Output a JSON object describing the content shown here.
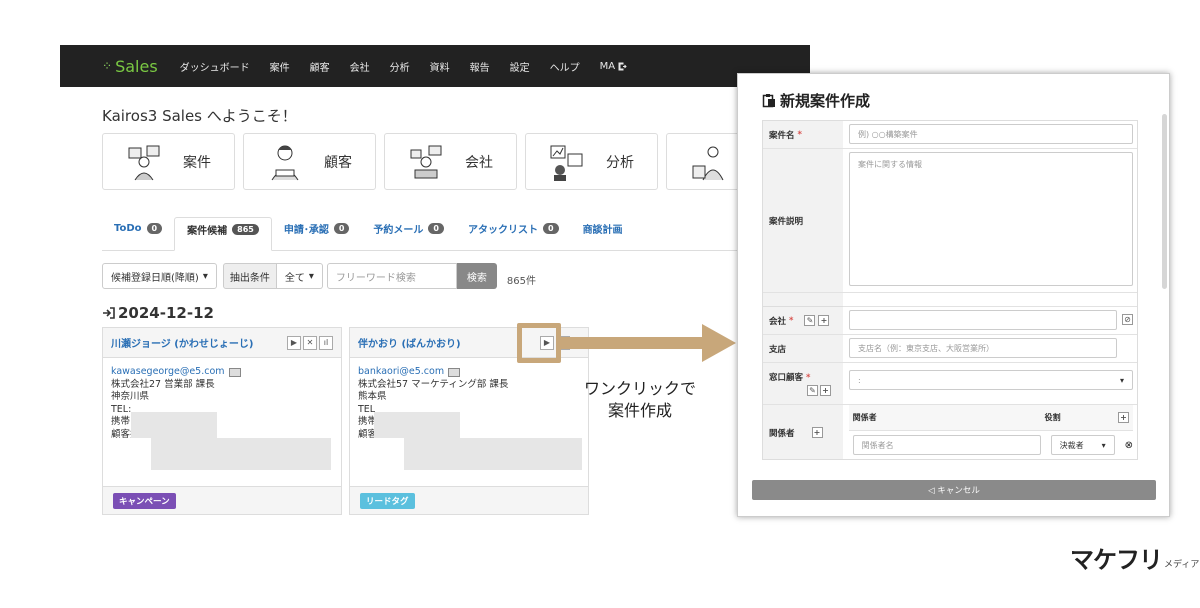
{
  "nav": {
    "logo": "Sales",
    "items": [
      "ダッシュボード",
      "案件",
      "顧客",
      "会社",
      "分析",
      "資料",
      "報告",
      "設定",
      "ヘルプ"
    ],
    "ma_label": "MA"
  },
  "welcome": "Kairos3 Sales へようこそ！",
  "tiles": [
    {
      "label": "案件"
    },
    {
      "label": "顧客"
    },
    {
      "label": "会社"
    },
    {
      "label": "分析"
    }
  ],
  "tabs": [
    {
      "label": "ToDo",
      "badge": "0"
    },
    {
      "label": "案件候補",
      "badge": "865"
    },
    {
      "label": "申請･承認",
      "badge": "0"
    },
    {
      "label": "予約メール",
      "badge": "0"
    },
    {
      "label": "アタックリスト",
      "badge": "0"
    },
    {
      "label": "商談計画",
      "badge": ""
    }
  ],
  "filters": {
    "sort": "候補登録日順(降順)",
    "extract_label": "抽出条件",
    "all": "全て",
    "search_placeholder": "フリーワード検索",
    "search_button": "検索",
    "count": "865件"
  },
  "date_heading": "2024-12-12",
  "cards": [
    {
      "name": "川瀬ジョージ (かわせじょーじ)",
      "email": "kawasegeorge@e5.com",
      "company": "株式会社27 営業部 課長",
      "pref": "神奈川県",
      "tel": "TEL:",
      "mobile": "携帯",
      "owner": "顧客担当",
      "tag": "キャンペーン",
      "tag_color": "#7b4fb5"
    },
    {
      "name": "伴かおり (ばんかおり)",
      "email": "bankaori@e5.com",
      "company": "株式会社57 マーケティング部 課長",
      "pref": "熊本県",
      "tel": "TEL",
      "mobile": "携帯",
      "owner": "顧客担当:",
      "tag": "リードタグ",
      "tag_color": "#5bc0de"
    }
  ],
  "caption": {
    "line1": "ワンクリックで",
    "line2": "案件作成"
  },
  "modal": {
    "title": "新規案件作成",
    "fields": {
      "name_label": "案件名",
      "name_placeholder": "例) ○○構築案件",
      "desc_label": "案件説明",
      "desc_placeholder": "案件に関する情報",
      "company_label": "会社",
      "branch_label": "支店",
      "branch_placeholder": "支店名（例：東京支店、大阪営業所）",
      "contact_label": "窓口顧客",
      "contact_value": ":",
      "related_label": "関係者",
      "related_col_person": "関係者",
      "related_col_role": "役割",
      "related_placeholder": "関係者名",
      "role_value": "決裁者"
    },
    "cancel": "◁ キャンセル"
  },
  "brand": {
    "main": "マケフリ",
    "sub": "メディア"
  }
}
